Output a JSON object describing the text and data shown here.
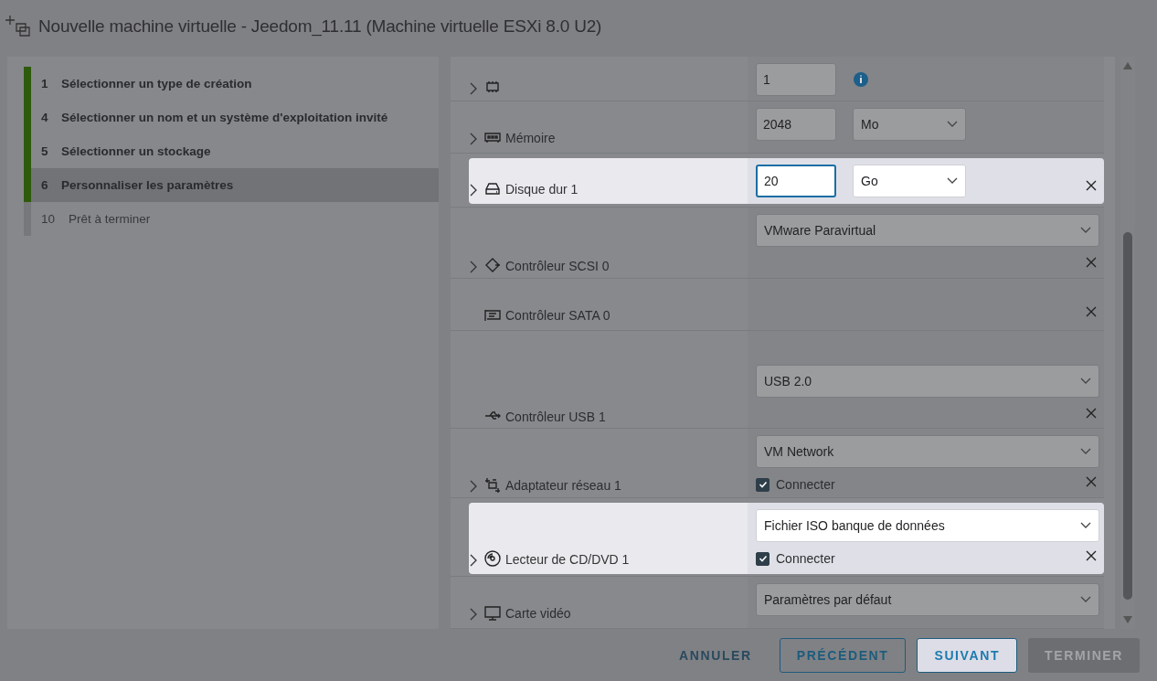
{
  "window": {
    "title": "Nouvelle machine virtuelle - Jeedom_11.11 (Machine virtuelle ESXi 8.0 U2)"
  },
  "steps": [
    {
      "number": "1",
      "label": "Sélectionner un type de création",
      "completed": true,
      "selected": false
    },
    {
      "number": "4",
      "label": "Sélectionner un nom et un système d'exploitation invité",
      "completed": true,
      "selected": false
    },
    {
      "number": "5",
      "label": "Sélectionner un stockage",
      "completed": true,
      "selected": false
    },
    {
      "number": "6",
      "label": "Personnaliser les paramètres",
      "completed": true,
      "selected": true
    },
    {
      "number": "10",
      "label": "Prêt à terminer",
      "completed": false,
      "selected": false
    }
  ],
  "hardware": [
    {
      "kind": "cpu",
      "expandable": true,
      "highlighted": false,
      "removable": false,
      "controls": [
        {
          "kind": "number",
          "value": "1",
          "focused": false
        },
        {
          "kind": "info"
        }
      ]
    },
    {
      "label": "Mémoire",
      "kind": "memory",
      "expandable": true,
      "highlighted": false,
      "removable": false,
      "controls": [
        {
          "kind": "number",
          "value": "2048",
          "focused": false
        },
        {
          "kind": "unit-select",
          "value": "Mo"
        }
      ]
    },
    {
      "label": "Disque dur 1",
      "kind": "disk",
      "expandable": true,
      "highlighted": true,
      "removable": true,
      "controls": [
        {
          "kind": "number",
          "value": "20",
          "focused": true
        },
        {
          "kind": "unit-select",
          "value": "Go"
        }
      ]
    },
    {
      "label": "Contrôleur SCSI 0",
      "kind": "scsi",
      "expandable": true,
      "highlighted": false,
      "removable": true,
      "controls": [
        {
          "kind": "select",
          "value": "VMware Paravirtual"
        },
        {
          "kind": "spacer"
        }
      ]
    },
    {
      "label": "Contrôleur SATA 0",
      "kind": "sata",
      "expandable": false,
      "highlighted": false,
      "removable": true
    },
    {
      "label": "Contrôleur USB 1",
      "kind": "usb",
      "expandable": false,
      "highlighted": false,
      "removable": true,
      "controls": [
        {
          "kind": "spacer"
        },
        {
          "kind": "select",
          "value": "USB 2.0"
        },
        {
          "kind": "spacer"
        }
      ]
    },
    {
      "label": "Adaptateur réseau 1",
      "kind": "network",
      "expandable": true,
      "highlighted": false,
      "removable": true,
      "controls": [
        {
          "kind": "select",
          "value": "VM Network"
        },
        {
          "kind": "checkbox",
          "label": "Connecter",
          "checked": true
        }
      ]
    },
    {
      "label": "Lecteur de CD/DVD 1",
      "kind": "cd",
      "expandable": true,
      "highlighted": true,
      "removable": true,
      "controls": [
        {
          "kind": "select",
          "value": "Fichier ISO banque de données"
        },
        {
          "kind": "checkbox",
          "label": "Connecter",
          "checked": true
        }
      ]
    },
    {
      "label": "Carte vidéo",
      "kind": "monitor",
      "expandable": true,
      "highlighted": false,
      "removable": false,
      "controls": [
        {
          "kind": "select",
          "value": "Paramètres par défaut"
        }
      ]
    }
  ],
  "buttons": [
    {
      "label": "ANNULER",
      "kind": "flat",
      "disabled": false
    },
    {
      "label": "PRÉCÉDENT",
      "kind": "outline",
      "disabled": false
    },
    {
      "label": "SUIVANT",
      "kind": "primary",
      "disabled": false
    },
    {
      "label": "TERMINER",
      "kind": "solid",
      "disabled": true
    }
  ]
}
